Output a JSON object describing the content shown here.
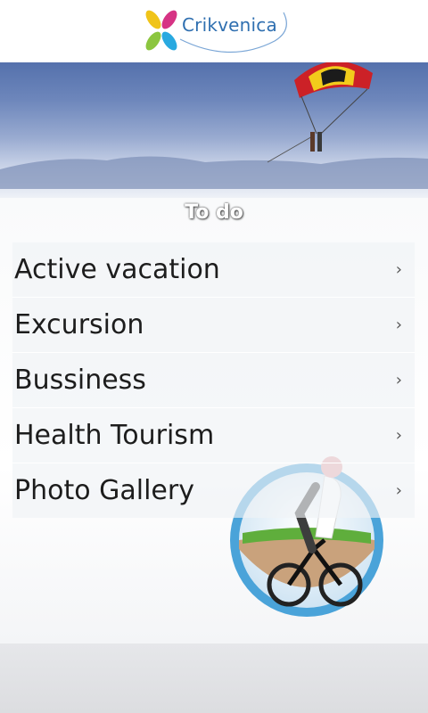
{
  "app": {
    "logo_text": "Crikvenica"
  },
  "section": {
    "title": "To do"
  },
  "menu": {
    "items": [
      {
        "label": "Active vacation",
        "chevron": "›"
      },
      {
        "label": "Excursion",
        "chevron": "›"
      },
      {
        "label": "Bussiness",
        "chevron": "›"
      },
      {
        "label": "Health Tourism",
        "chevron": "›"
      },
      {
        "label": "Photo Gallery",
        "chevron": "›"
      }
    ]
  },
  "icons": {
    "logo": "crikvenica-flower-logo",
    "banner": "parasailing-photo",
    "illustration": "cyclist-badge"
  },
  "colors": {
    "brand_blue": "#2f6fb0",
    "sky": "#4a68a6"
  }
}
